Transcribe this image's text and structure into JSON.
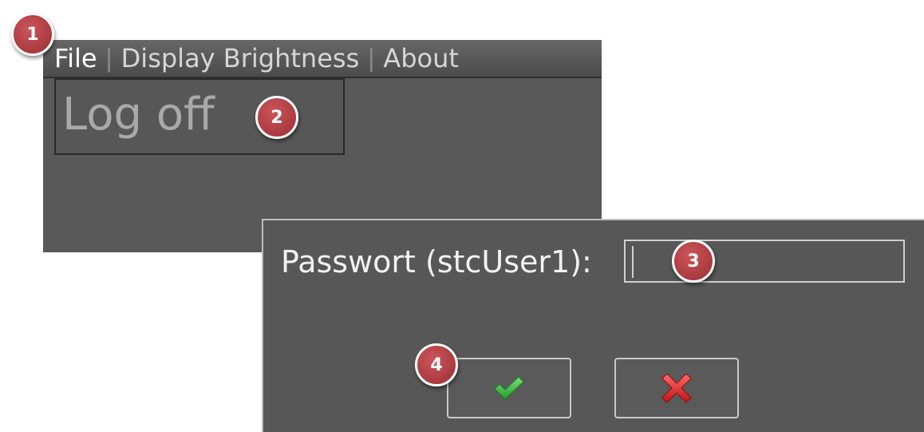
{
  "menubar": {
    "items": [
      {
        "label": "File"
      },
      {
        "label": "Display Brightness"
      },
      {
        "label": "About"
      }
    ],
    "separator": "|"
  },
  "file_menu": {
    "items": [
      {
        "label": "Log off"
      }
    ]
  },
  "password_dialog": {
    "label": "Passwort (stcUser1):",
    "input_value": "",
    "ok_icon": "checkmark-icon",
    "cancel_icon": "red-x-icon"
  },
  "badges": [
    "1",
    "2",
    "3",
    "4"
  ],
  "colors": {
    "badge": "#b2393e",
    "window_bg": "#595959",
    "ok_green": "#3cb83c",
    "cancel_red": "#d91e1e"
  }
}
